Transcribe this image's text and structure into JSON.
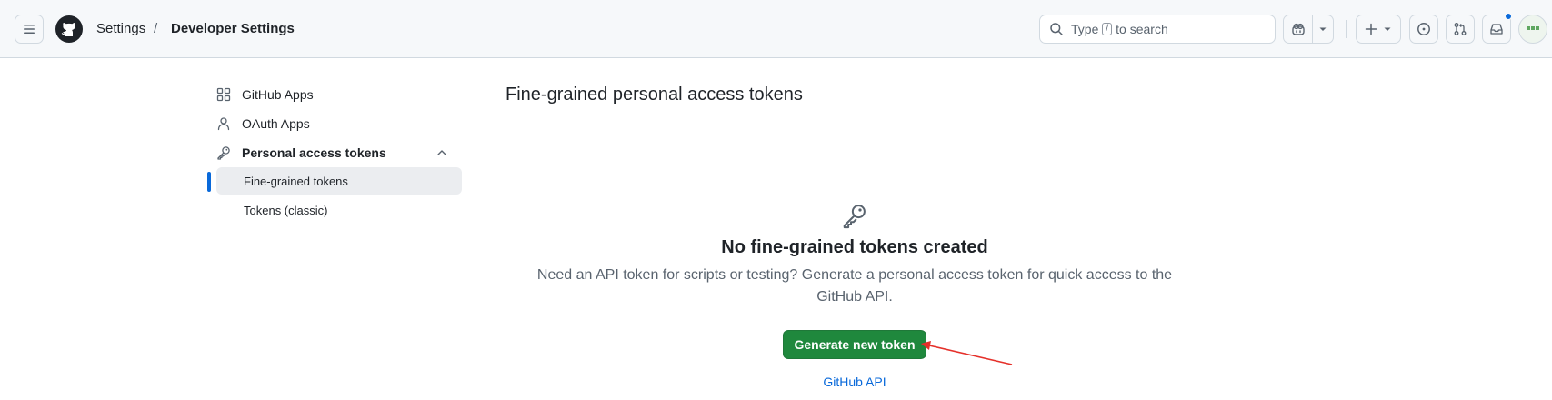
{
  "header": {
    "breadcrumb": {
      "settings": "Settings",
      "separator": "/",
      "current": "Developer Settings"
    },
    "search": {
      "prefix": "Type",
      "key": "/",
      "suffix": "to search"
    }
  },
  "sidebar": {
    "items": [
      {
        "label": "GitHub Apps",
        "icon": "apps-icon"
      },
      {
        "label": "OAuth Apps",
        "icon": "person-icon"
      },
      {
        "label": "Personal access tokens",
        "icon": "key-icon",
        "expanded": true
      }
    ],
    "subitems": [
      {
        "label": "Fine-grained tokens",
        "active": true
      },
      {
        "label": "Tokens (classic)",
        "active": false
      }
    ]
  },
  "main": {
    "title": "Fine-grained personal access tokens",
    "blankslate": {
      "icon": "key-icon",
      "heading": "No fine-grained tokens created",
      "description": "Need an API token for scripts or testing? Generate a personal access token for quick access to the GitHub API.",
      "button": "Generate new token",
      "link": "GitHub API"
    }
  },
  "colors": {
    "primary_button": "#1f883d",
    "link": "#0969da",
    "active_indicator": "#0969da",
    "annotation_arrow": "#e5302a"
  }
}
